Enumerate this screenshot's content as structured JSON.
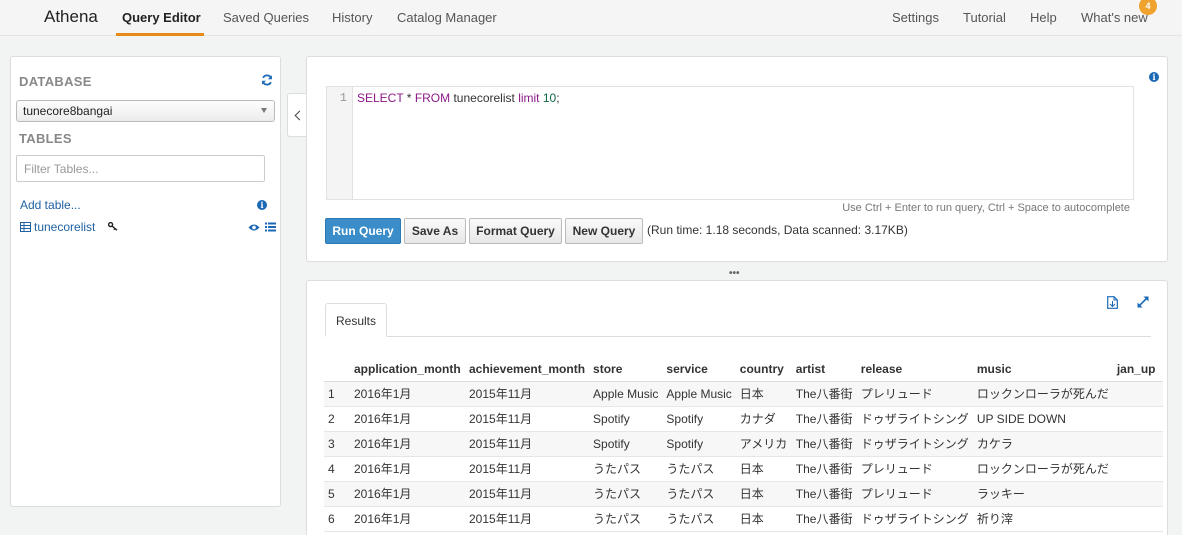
{
  "nav": {
    "brand": "Athena",
    "tabs": [
      {
        "label": "Query Editor"
      },
      {
        "label": "Saved Queries"
      },
      {
        "label": "History"
      },
      {
        "label": "Catalog Manager"
      }
    ],
    "right": [
      {
        "label": "Settings"
      },
      {
        "label": "Tutorial"
      },
      {
        "label": "Help"
      },
      {
        "label": "What's new"
      }
    ],
    "badge": "4",
    "accent_color": "#e8891c"
  },
  "sidebar": {
    "database_label": "DATABASE",
    "database_value": "tunecore8bangai",
    "tables_label": "TABLES",
    "filter_placeholder": "Filter Tables...",
    "add_table": "Add table...",
    "tables": [
      {
        "name": "tunecorelist"
      }
    ]
  },
  "editor": {
    "line_number": "1",
    "code": {
      "kw1": "SELECT",
      "t1": " * ",
      "kw2": "FROM",
      "t2": " tunecorelist ",
      "kw3": "limit",
      "t3": " ",
      "num": "10",
      "t4": ";"
    },
    "hint": "Use Ctrl + Enter to run query, Ctrl + Space to autocomplete",
    "buttons": {
      "run": "Run Query",
      "save_as": "Save As",
      "format": "Format Query",
      "new": "New Query"
    },
    "run_info": "(Run time: 1.18 seconds, Data scanned: 3.17KB)",
    "primary_color": "#3b8dca"
  },
  "results": {
    "tab_label": "Results",
    "columns": [
      "application_month",
      "achievement_month",
      "store",
      "service",
      "country",
      "artist",
      "release",
      "music",
      "jan_up"
    ],
    "rows": [
      {
        "n": "1",
        "cells": [
          "2016年1月",
          "2015年11月",
          "Apple Music",
          "Apple Music",
          "日本",
          "The八番街",
          "プレリュード",
          "ロックンローラが死んだ",
          ""
        ]
      },
      {
        "n": "2",
        "cells": [
          "2016年1月",
          "2015年11月",
          "Spotify",
          "Spotify",
          "カナダ",
          "The八番街",
          "ドゥザライトシング",
          "UP SIDE DOWN",
          ""
        ]
      },
      {
        "n": "3",
        "cells": [
          "2016年1月",
          "2015年11月",
          "Spotify",
          "Spotify",
          "アメリカ",
          "The八番街",
          "ドゥザライトシング",
          "カケラ",
          ""
        ]
      },
      {
        "n": "4",
        "cells": [
          "2016年1月",
          "2015年11月",
          "うたパス",
          "うたパス",
          "日本",
          "The八番街",
          "プレリュード",
          "ロックンローラが死んだ",
          ""
        ]
      },
      {
        "n": "5",
        "cells": [
          "2016年1月",
          "2015年11月",
          "うたパス",
          "うたパス",
          "日本",
          "The八番街",
          "プレリュード",
          "ラッキー",
          ""
        ]
      },
      {
        "n": "6",
        "cells": [
          "2016年1月",
          "2015年11月",
          "うたパス",
          "うたパス",
          "日本",
          "The八番街",
          "ドゥザライトシング",
          "祈り滓",
          ""
        ]
      }
    ]
  }
}
